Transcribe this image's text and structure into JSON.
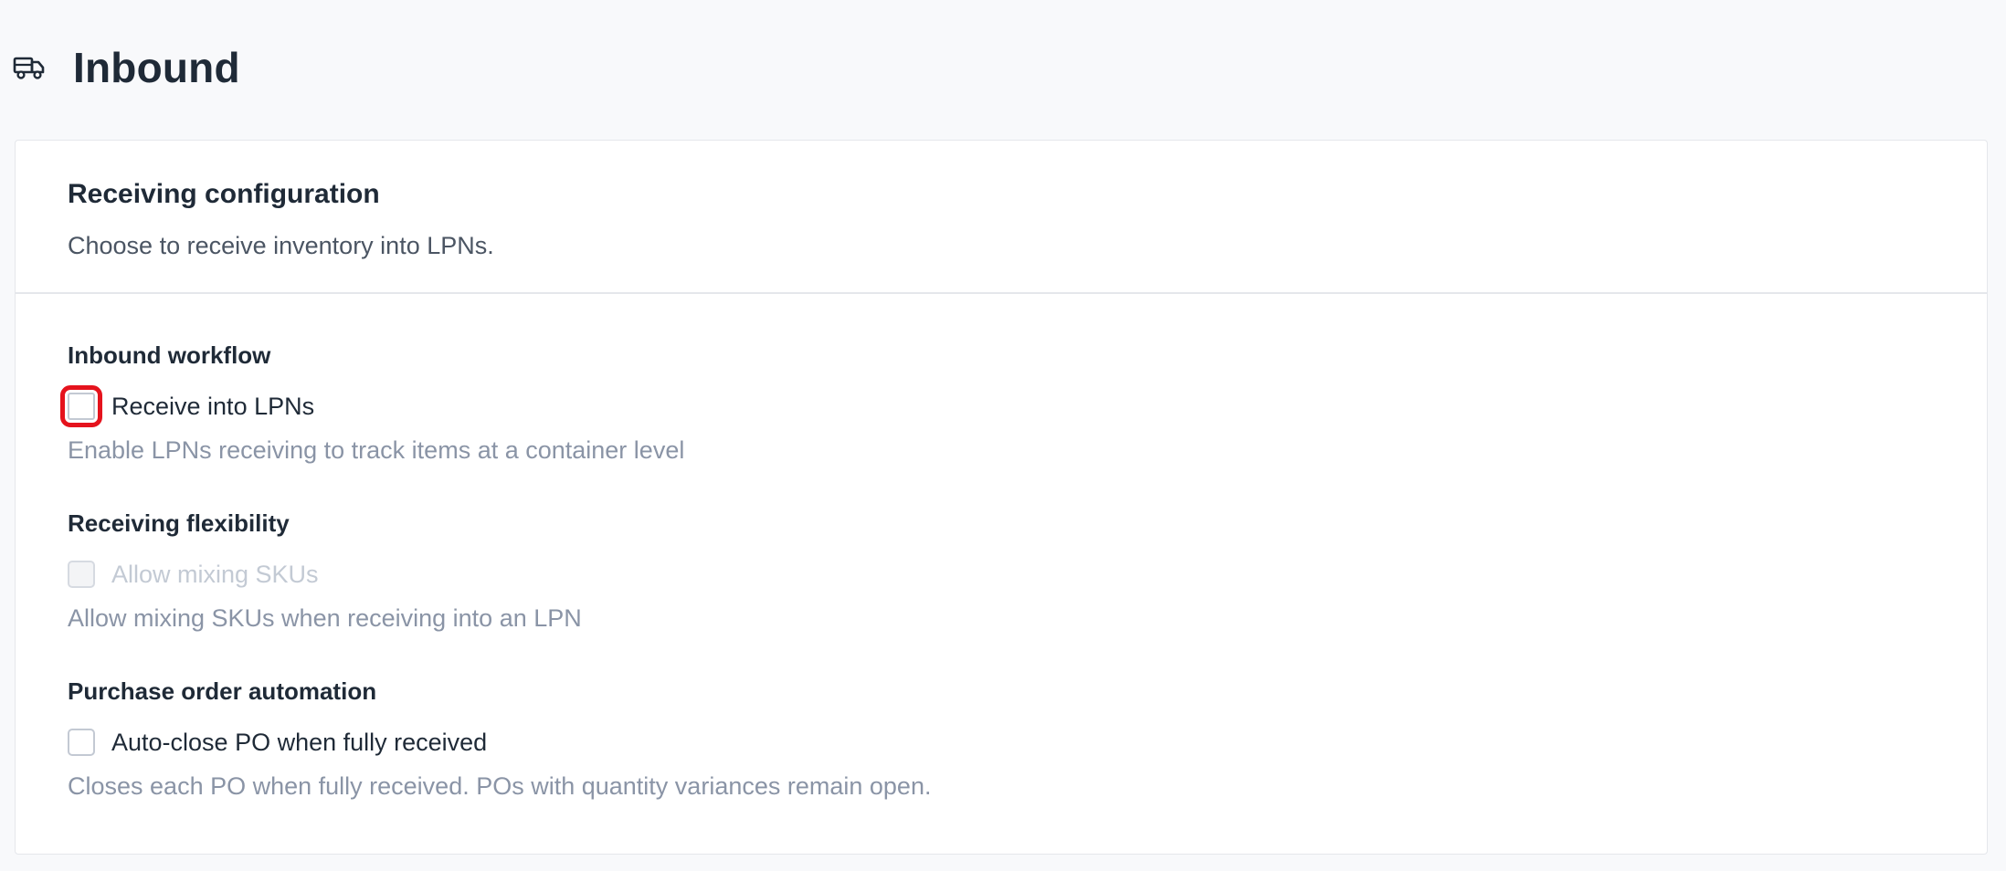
{
  "page": {
    "title": "Inbound",
    "icon": "truck-icon"
  },
  "card": {
    "title": "Receiving configuration",
    "subtitle": "Choose to receive inventory into LPNs."
  },
  "sections": [
    {
      "title": "Inbound workflow",
      "option_label": "Receive into LPNs",
      "option_desc": "Enable LPNs receiving to track items at a container level",
      "checked": false,
      "disabled": false,
      "focused": true
    },
    {
      "title": "Receiving flexibility",
      "option_label": "Allow mixing SKUs",
      "option_desc": "Allow mixing SKUs when receiving into an LPN",
      "checked": false,
      "disabled": true,
      "focused": false
    },
    {
      "title": "Purchase order automation",
      "option_label": "Auto-close PO when fully received",
      "option_desc": "Closes each PO when fully received. POs with quantity variances remain open.",
      "checked": false,
      "disabled": false,
      "focused": false
    }
  ],
  "colors": {
    "focus_outline": "#e5131d",
    "text_primary": "#1f2a37",
    "text_muted": "#8a94a6",
    "text_disabled": "#c3cad4"
  }
}
